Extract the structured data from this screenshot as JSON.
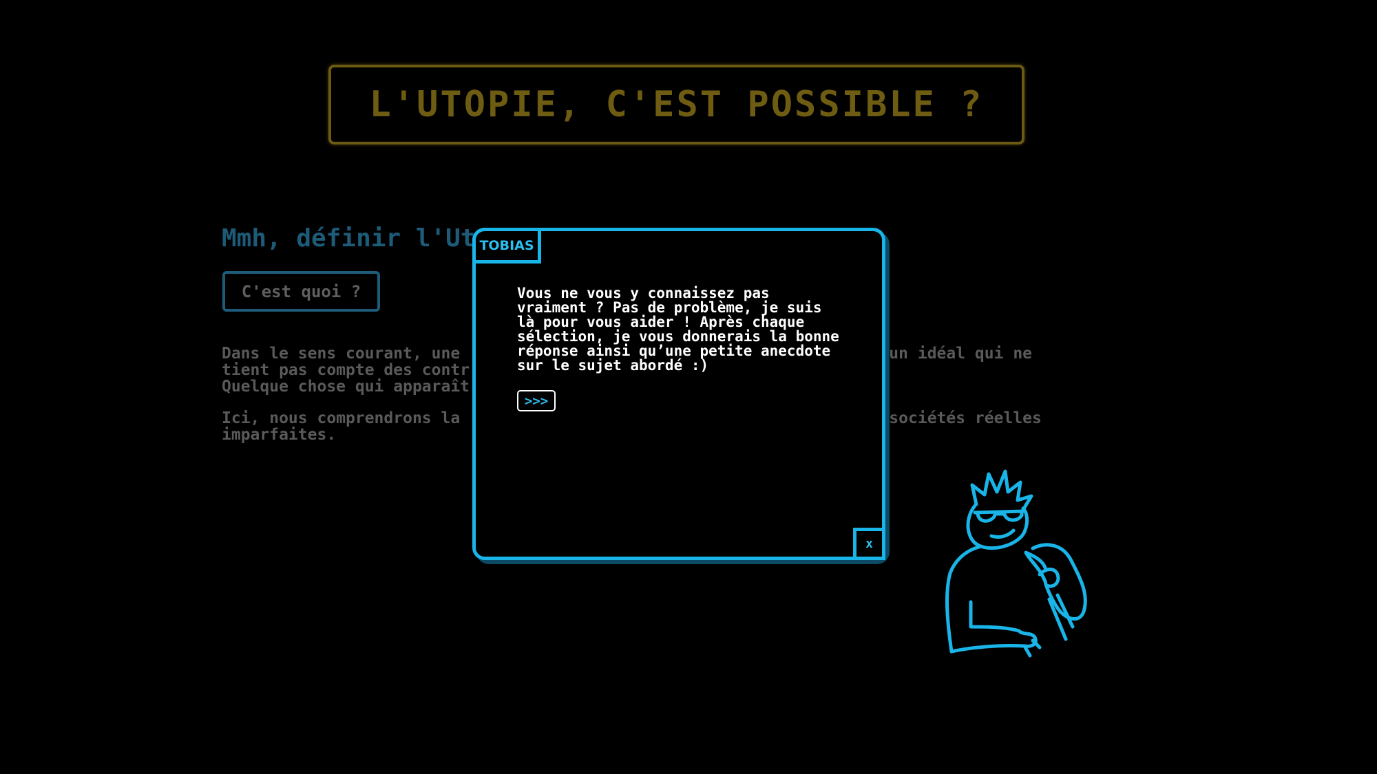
{
  "page": {
    "title": "L'UTOPIE, C'EST POSSIBLE ?"
  },
  "content": {
    "heading": "Mmh, définir l'Ut",
    "what_button": "C'est quoi ?",
    "paragraph1": "Dans le sens courant, une                                      que ou un idéal qui ne\ntient pas compte des contr\nQuelque chose qui apparaît                                     ue.",
    "paragraph2": "Ici, nous comprendrons la                                      ée aux sociétés réelles\nimparfaites."
  },
  "dialog": {
    "speaker": "TOBIAS",
    "message": "Vous ne vous y connaissez pas\nvraiment ? Pas de problème, je suis\nlà pour vous aider ! Après chaque\nsélection, je vous donnerais la bonne\nréponse ainsi qu’une petite anecdote\nsur le sujet abordé :)",
    "next_label": ">>>",
    "close_label": "x"
  },
  "colors": {
    "accent": "#19b5e8",
    "title": "#6e5c12",
    "dim_text": "#5a5a5a",
    "dim_accent": "#1d5b78"
  },
  "icons": {
    "character": "tobias-character-icon"
  }
}
